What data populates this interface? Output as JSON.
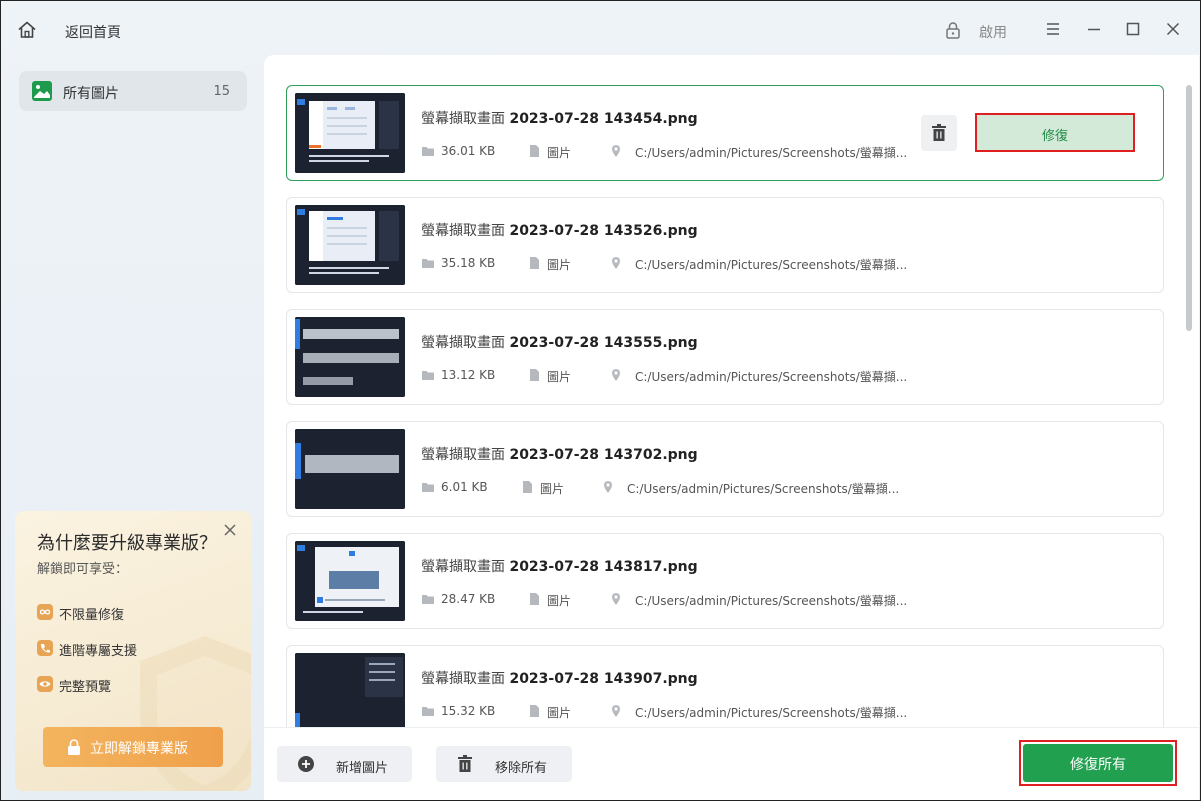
{
  "titlebar": {
    "back_label": "返回首頁",
    "activate_label": "啟用"
  },
  "sidebar": {
    "items": [
      {
        "label": "所有圖片",
        "count": "15"
      }
    ]
  },
  "promo": {
    "title": "為什麼要升級專業版？",
    "subtitle": "解鎖即可享受：",
    "features": [
      {
        "icon": "infinity-icon",
        "label": "不限量修復"
      },
      {
        "icon": "support-icon",
        "label": "進階專屬支援"
      },
      {
        "icon": "eye-icon",
        "label": "完整預覽"
      }
    ],
    "unlock_label": "立即解鎖專業版"
  },
  "files": [
    {
      "prefix": "螢幕擷取畫面",
      "name": "2023-07-28 143454.png",
      "size": "36.01 KB",
      "type": "圖片",
      "path": "C:/Users/admin/Pictures/Screenshots/螢幕擷..."
    },
    {
      "prefix": "螢幕擷取畫面",
      "name": "2023-07-28 143526.png",
      "size": "35.18 KB",
      "type": "圖片",
      "path": "C:/Users/admin/Pictures/Screenshots/螢幕擷..."
    },
    {
      "prefix": "螢幕擷取畫面",
      "name": "2023-07-28 143555.png",
      "size": "13.12 KB",
      "type": "圖片",
      "path": "C:/Users/admin/Pictures/Screenshots/螢幕擷..."
    },
    {
      "prefix": "螢幕擷取畫面",
      "name": "2023-07-28 143702.png",
      "size": "6.01 KB",
      "type": "圖片",
      "path": "C:/Users/admin/Pictures/Screenshots/螢幕擷..."
    },
    {
      "prefix": "螢幕擷取畫面",
      "name": "2023-07-28 143817.png",
      "size": "28.47 KB",
      "type": "圖片",
      "path": "C:/Users/admin/Pictures/Screenshots/螢幕擷..."
    },
    {
      "prefix": "螢幕擷取畫面",
      "name": "2023-07-28 143907.png",
      "size": "15.32 KB",
      "type": "圖片",
      "path": "C:/Users/admin/Pictures/Screenshots/螢幕擷..."
    }
  ],
  "card_actions": {
    "repair_label": "修復"
  },
  "bottombar": {
    "add_label": "新增圖片",
    "remove_label": "移除所有",
    "repair_all_label": "修復所有"
  },
  "colors": {
    "accent_green": "#21a04f",
    "highlight_red": "#e02020",
    "promo_orange": "#f0a04a"
  }
}
